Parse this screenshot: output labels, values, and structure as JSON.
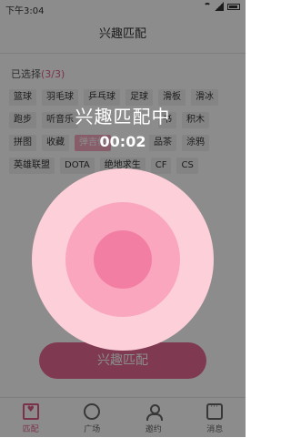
{
  "status_bar": {
    "time": "下午3:04"
  },
  "header": {
    "title": "兴趣匹配"
  },
  "selection": {
    "label": "已选择",
    "count": "(3/3)"
  },
  "tags": [
    [
      "篮球",
      "羽毛球",
      "乒乓球",
      "足球",
      "滑板",
      "滑冰"
    ],
    [
      "跑步",
      "听音乐",
      "",
      "",
      "书",
      "积木"
    ],
    [
      "拼图",
      "收藏",
      "弹吉他",
      "",
      "品茶",
      "涂鸦"
    ],
    [
      "英雄联盟",
      "DOTA",
      "绝地求生",
      "CF",
      "CS"
    ]
  ],
  "button": {
    "label": "兴趣匹配"
  },
  "tabbar": [
    {
      "label": "匹配",
      "icon": "match-icon"
    },
    {
      "label": "广场",
      "icon": "plaza-icon"
    },
    {
      "label": "邀约",
      "icon": "date-icon"
    },
    {
      "label": "消息",
      "icon": "message-icon"
    }
  ],
  "overlay": {
    "title": "兴趣匹配中",
    "timer": "00:02"
  },
  "colors": {
    "accent": "#e05c86",
    "ripple_outer": "#fccfd9",
    "ripple_mid": "#f9a6be",
    "ripple_inner": "#f37ea4"
  }
}
